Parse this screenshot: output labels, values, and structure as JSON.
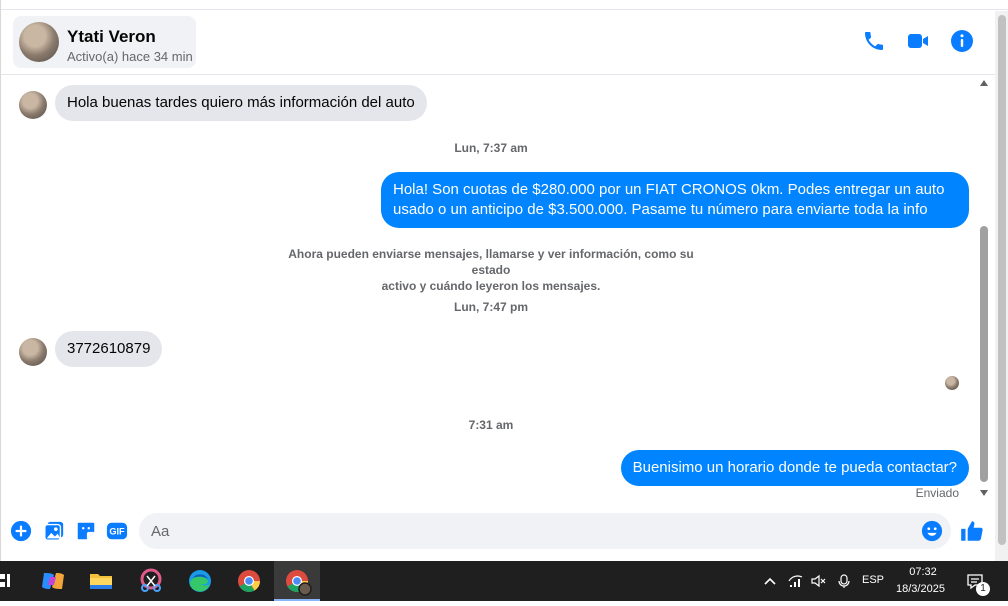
{
  "header": {
    "contact_name": "Ytati Veron",
    "contact_status": "Activo(a) hace 34 min",
    "call_icon": "phone-icon",
    "video_icon": "video-camera-icon",
    "info_icon": "info-icon"
  },
  "messages": [
    {
      "direction": "in",
      "text": "Hola buenas tardes quiero más información del auto"
    },
    {
      "type": "timestamp",
      "text": "Lun, 7:37 am"
    },
    {
      "direction": "out",
      "line1": "Hola! Son cuotas de $280.000 por un FIAT CRONOS 0km. Podes entregar un auto",
      "line2": "usado o un anticipo de $3.500.000. Pasame tu número para enviarte toda la info"
    },
    {
      "type": "notice",
      "line1": "Ahora pueden enviarse mensajes, llamarse y ver información, como su estado",
      "line2": "activo y cuándo leyeron los mensajes."
    },
    {
      "type": "timestamp",
      "text": "Lun, 7:47 pm"
    },
    {
      "direction": "in",
      "text": "3772610879"
    },
    {
      "type": "timestamp",
      "text": "7:31 am"
    },
    {
      "direction": "out",
      "text": "Buenisimo un horario donde te pueda contactar?",
      "status": "Enviado"
    }
  ],
  "composer": {
    "placeholder": "Aa",
    "icons": [
      "plus-circle-icon",
      "photo-icon",
      "sticker-icon",
      "gif-icon",
      "emoji-icon",
      "thumbs-up-icon"
    ]
  },
  "colors": {
    "accent": "#0084ff",
    "messenger_blue": "#0a7cff",
    "incoming_bubble": "#e4e6eb",
    "taskbar": "#1f1f1f"
  },
  "taskbar": {
    "apps": [
      "task-view-icon",
      "copilot-icon",
      "file-explorer-icon",
      "snipping-tool-icon",
      "edge-icon",
      "chrome-icon",
      "chrome-profile-icon"
    ],
    "language": "ESP",
    "time": "07:32",
    "date": "18/3/2025",
    "notification_count": "1"
  }
}
